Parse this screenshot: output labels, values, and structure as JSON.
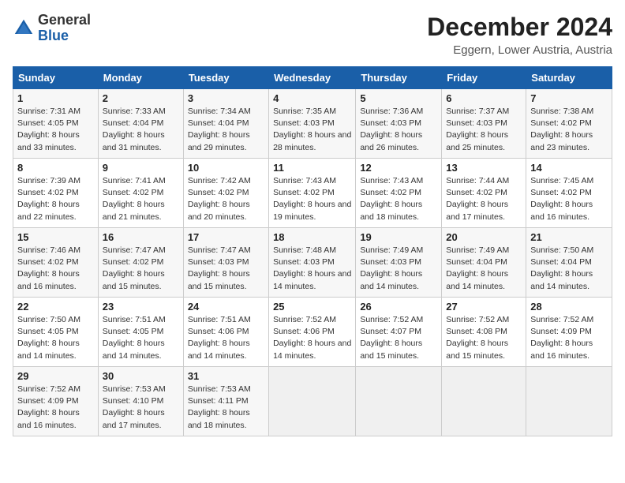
{
  "header": {
    "logo_general": "General",
    "logo_blue": "Blue",
    "month_title": "December 2024",
    "location": "Eggern, Lower Austria, Austria"
  },
  "weekdays": [
    "Sunday",
    "Monday",
    "Tuesday",
    "Wednesday",
    "Thursday",
    "Friday",
    "Saturday"
  ],
  "weeks": [
    [
      {
        "day": "1",
        "sunrise": "7:31 AM",
        "sunset": "4:05 PM",
        "daylight": "8 hours and 33 minutes."
      },
      {
        "day": "2",
        "sunrise": "7:33 AM",
        "sunset": "4:04 PM",
        "daylight": "8 hours and 31 minutes."
      },
      {
        "day": "3",
        "sunrise": "7:34 AM",
        "sunset": "4:04 PM",
        "daylight": "8 hours and 29 minutes."
      },
      {
        "day": "4",
        "sunrise": "7:35 AM",
        "sunset": "4:03 PM",
        "daylight": "8 hours and 28 minutes."
      },
      {
        "day": "5",
        "sunrise": "7:36 AM",
        "sunset": "4:03 PM",
        "daylight": "8 hours and 26 minutes."
      },
      {
        "day": "6",
        "sunrise": "7:37 AM",
        "sunset": "4:03 PM",
        "daylight": "8 hours and 25 minutes."
      },
      {
        "day": "7",
        "sunrise": "7:38 AM",
        "sunset": "4:02 PM",
        "daylight": "8 hours and 23 minutes."
      }
    ],
    [
      {
        "day": "8",
        "sunrise": "7:39 AM",
        "sunset": "4:02 PM",
        "daylight": "8 hours and 22 minutes."
      },
      {
        "day": "9",
        "sunrise": "7:41 AM",
        "sunset": "4:02 PM",
        "daylight": "8 hours and 21 minutes."
      },
      {
        "day": "10",
        "sunrise": "7:42 AM",
        "sunset": "4:02 PM",
        "daylight": "8 hours and 20 minutes."
      },
      {
        "day": "11",
        "sunrise": "7:43 AM",
        "sunset": "4:02 PM",
        "daylight": "8 hours and 19 minutes."
      },
      {
        "day": "12",
        "sunrise": "7:43 AM",
        "sunset": "4:02 PM",
        "daylight": "8 hours and 18 minutes."
      },
      {
        "day": "13",
        "sunrise": "7:44 AM",
        "sunset": "4:02 PM",
        "daylight": "8 hours and 17 minutes."
      },
      {
        "day": "14",
        "sunrise": "7:45 AM",
        "sunset": "4:02 PM",
        "daylight": "8 hours and 16 minutes."
      }
    ],
    [
      {
        "day": "15",
        "sunrise": "7:46 AM",
        "sunset": "4:02 PM",
        "daylight": "8 hours and 16 minutes."
      },
      {
        "day": "16",
        "sunrise": "7:47 AM",
        "sunset": "4:02 PM",
        "daylight": "8 hours and 15 minutes."
      },
      {
        "day": "17",
        "sunrise": "7:47 AM",
        "sunset": "4:03 PM",
        "daylight": "8 hours and 15 minutes."
      },
      {
        "day": "18",
        "sunrise": "7:48 AM",
        "sunset": "4:03 PM",
        "daylight": "8 hours and 14 minutes."
      },
      {
        "day": "19",
        "sunrise": "7:49 AM",
        "sunset": "4:03 PM",
        "daylight": "8 hours and 14 minutes."
      },
      {
        "day": "20",
        "sunrise": "7:49 AM",
        "sunset": "4:04 PM",
        "daylight": "8 hours and 14 minutes."
      },
      {
        "day": "21",
        "sunrise": "7:50 AM",
        "sunset": "4:04 PM",
        "daylight": "8 hours and 14 minutes."
      }
    ],
    [
      {
        "day": "22",
        "sunrise": "7:50 AM",
        "sunset": "4:05 PM",
        "daylight": "8 hours and 14 minutes."
      },
      {
        "day": "23",
        "sunrise": "7:51 AM",
        "sunset": "4:05 PM",
        "daylight": "8 hours and 14 minutes."
      },
      {
        "day": "24",
        "sunrise": "7:51 AM",
        "sunset": "4:06 PM",
        "daylight": "8 hours and 14 minutes."
      },
      {
        "day": "25",
        "sunrise": "7:52 AM",
        "sunset": "4:06 PM",
        "daylight": "8 hours and 14 minutes."
      },
      {
        "day": "26",
        "sunrise": "7:52 AM",
        "sunset": "4:07 PM",
        "daylight": "8 hours and 15 minutes."
      },
      {
        "day": "27",
        "sunrise": "7:52 AM",
        "sunset": "4:08 PM",
        "daylight": "8 hours and 15 minutes."
      },
      {
        "day": "28",
        "sunrise": "7:52 AM",
        "sunset": "4:09 PM",
        "daylight": "8 hours and 16 minutes."
      }
    ],
    [
      {
        "day": "29",
        "sunrise": "7:52 AM",
        "sunset": "4:09 PM",
        "daylight": "8 hours and 16 minutes."
      },
      {
        "day": "30",
        "sunrise": "7:53 AM",
        "sunset": "4:10 PM",
        "daylight": "8 hours and 17 minutes."
      },
      {
        "day": "31",
        "sunrise": "7:53 AM",
        "sunset": "4:11 PM",
        "daylight": "8 hours and 18 minutes."
      },
      null,
      null,
      null,
      null
    ]
  ],
  "labels": {
    "sunrise": "Sunrise:",
    "sunset": "Sunset:",
    "daylight": "Daylight:"
  }
}
